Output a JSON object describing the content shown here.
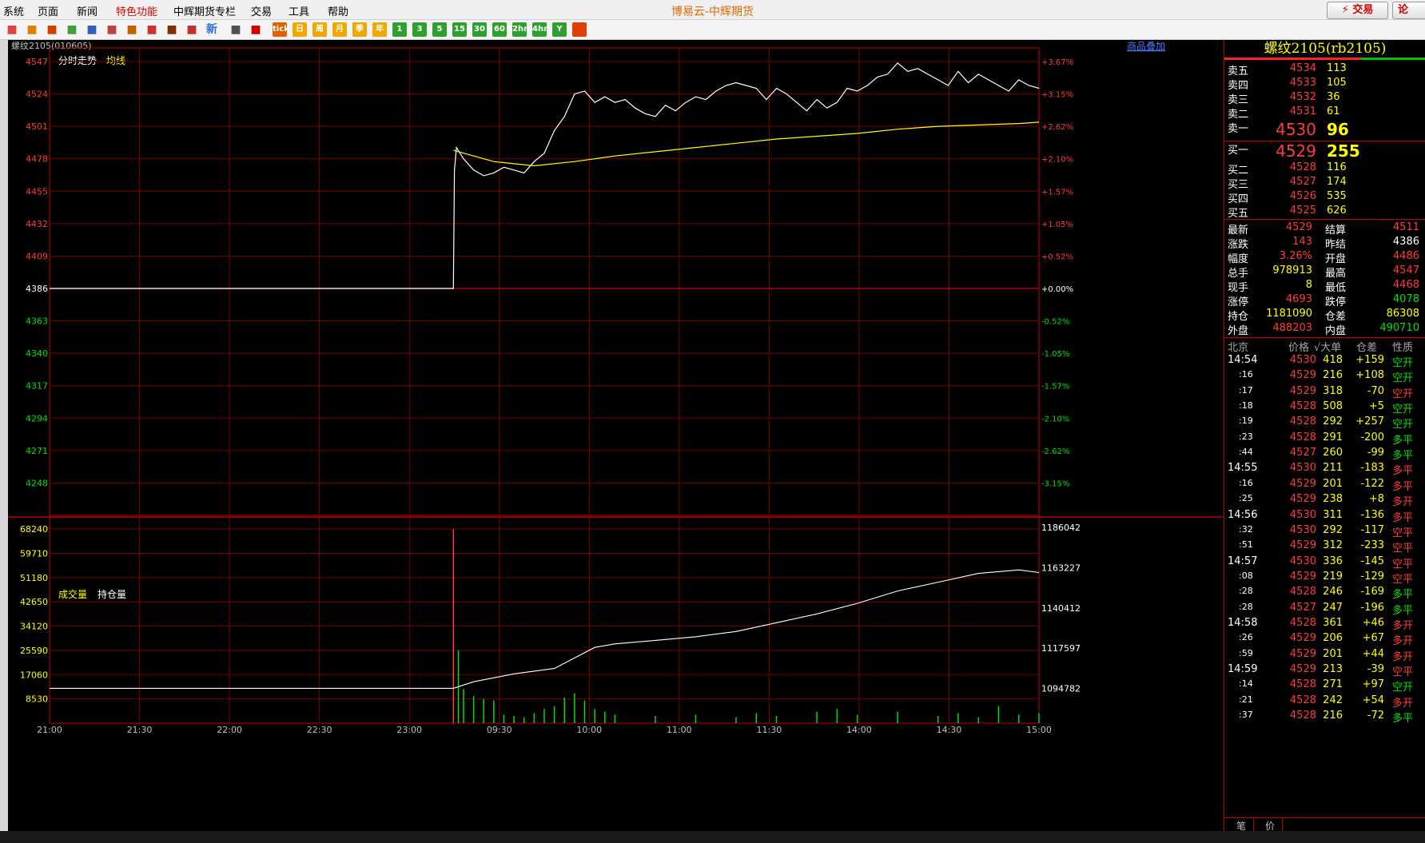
{
  "menu": {
    "items": [
      "系统",
      "页面",
      "新闻",
      "特色功能",
      "中辉期货专栏",
      "交易",
      "工具",
      "帮助"
    ],
    "highlight_index": 3
  },
  "app_title": "博易云-中辉期货",
  "buttons": {
    "trade": "⚡ 交易",
    "forum": "论"
  },
  "toolbar_icons": [
    "home-icon",
    "window-icon",
    "chart-icon",
    "refresh-icon",
    "search-icon",
    "zoom-icon",
    "layout-icon",
    "pen-icon",
    "draw-icon",
    "filter-icon",
    "news-icon",
    "table-icon",
    "trend-icon",
    "tick-icon",
    "day-icon",
    "week-icon",
    "month-icon",
    "quarter-icon",
    "year-icon",
    "1m-icon",
    "3m-icon",
    "5m-icon",
    "15m-icon",
    "30m-icon",
    "60m-icon",
    "2h-icon",
    "4h-icon",
    "y-icon",
    "calc-icon"
  ],
  "toolbar_labels": [
    "",
    "",
    "",
    "",
    "",
    "",
    "",
    "",
    "",
    "",
    "新",
    "",
    "",
    "tick",
    "日",
    "周",
    "月",
    "季",
    "年",
    "1",
    "3",
    "5",
    "15",
    "30",
    "60",
    "2hr",
    "4hr",
    "Y",
    ""
  ],
  "chart": {
    "symbol_header": "螺纹2105(010605)",
    "overlay_link": "商品叠加",
    "price_legend": [
      "分时走势",
      "均线"
    ],
    "volume_legend": [
      "成交量",
      "持仓量"
    ]
  },
  "chart_data": {
    "type": "line",
    "price_axis_ticks": [
      4547,
      4524,
      4501,
      4478,
      4455,
      4432,
      4409,
      4386,
      4363,
      4340,
      4317,
      4294,
      4271,
      4248
    ],
    "percent_axis_ticks": [
      "+3.67%",
      "+3.15%",
      "+2.62%",
      "+2.10%",
      "+1.57%",
      "+1.05%",
      "+0.52%",
      "+0.00%",
      "-0.52%",
      "-1.05%",
      "-1.57%",
      "-2.10%",
      "-2.62%",
      "-3.15%"
    ],
    "prev_settle": 4386,
    "ylim": [
      4225,
      4547
    ],
    "volume_ticks": [
      68240,
      59710,
      51180,
      42650,
      34120,
      25590,
      17060,
      8530
    ],
    "open_interest_ticks": [
      1186042,
      1163227,
      1140412,
      1117597,
      1094782
    ],
    "time_labels": [
      "21:00",
      "21:30",
      "22:00",
      "22:30",
      "23:00",
      "09:30",
      "10:00",
      "11:00",
      "11:30",
      "14:00",
      "14:30",
      "15:00"
    ],
    "price_series": [
      [
        0,
        4386
      ],
      [
        40,
        4386
      ],
      [
        40.1,
        4470
      ],
      [
        40.3,
        4486
      ],
      [
        41,
        4478
      ],
      [
        42,
        4470
      ],
      [
        43,
        4466
      ],
      [
        44,
        4468
      ],
      [
        45,
        4472
      ],
      [
        46,
        4470
      ],
      [
        47,
        4468
      ],
      [
        48,
        4476
      ],
      [
        49,
        4482
      ],
      [
        50,
        4498
      ],
      [
        51,
        4508
      ],
      [
        52,
        4524
      ],
      [
        53,
        4526
      ],
      [
        54,
        4518
      ],
      [
        55,
        4522
      ],
      [
        56,
        4518
      ],
      [
        57,
        4520
      ],
      [
        58,
        4514
      ],
      [
        59,
        4510
      ],
      [
        60,
        4508
      ],
      [
        61,
        4516
      ],
      [
        62,
        4512
      ],
      [
        63,
        4518
      ],
      [
        64,
        4522
      ],
      [
        65,
        4520
      ],
      [
        66,
        4526
      ],
      [
        67,
        4530
      ],
      [
        68,
        4532
      ],
      [
        69,
        4530
      ],
      [
        70,
        4528
      ],
      [
        71,
        4520
      ],
      [
        72,
        4528
      ],
      [
        73,
        4524
      ],
      [
        74,
        4518
      ],
      [
        75,
        4512
      ],
      [
        76,
        4520
      ],
      [
        77,
        4514
      ],
      [
        78,
        4518
      ],
      [
        79,
        4528
      ],
      [
        80,
        4526
      ],
      [
        81,
        4530
      ],
      [
        82,
        4536
      ],
      [
        83,
        4538
      ],
      [
        84,
        4546
      ],
      [
        85,
        4540
      ],
      [
        86,
        4542
      ],
      [
        87,
        4538
      ],
      [
        88,
        4534
      ],
      [
        89,
        4530
      ],
      [
        90,
        4540
      ],
      [
        91,
        4532
      ],
      [
        92,
        4538
      ],
      [
        93,
        4534
      ],
      [
        94,
        4530
      ],
      [
        95,
        4526
      ],
      [
        96,
        4534
      ],
      [
        97,
        4530
      ],
      [
        98,
        4528
      ]
    ],
    "avg_series": [
      [
        40,
        4484
      ],
      [
        44,
        4476
      ],
      [
        48,
        4473
      ],
      [
        52,
        4476
      ],
      [
        56,
        4480
      ],
      [
        60,
        4483
      ],
      [
        64,
        4486
      ],
      [
        68,
        4489
      ],
      [
        72,
        4492
      ],
      [
        76,
        4494
      ],
      [
        80,
        4496
      ],
      [
        84,
        4499
      ],
      [
        88,
        4501
      ],
      [
        92,
        4502
      ],
      [
        96,
        4503
      ],
      [
        98,
        4504
      ]
    ],
    "volume_series": [
      [
        40,
        68240
      ],
      [
        40.5,
        25590
      ],
      [
        41,
        12000
      ],
      [
        42,
        9500
      ],
      [
        43,
        8500
      ],
      [
        44,
        8000
      ],
      [
        45,
        3000
      ],
      [
        46,
        2500
      ],
      [
        47,
        2000
      ],
      [
        48,
        3500
      ],
      [
        49,
        5000
      ],
      [
        50,
        6000
      ],
      [
        51,
        9000
      ],
      [
        52,
        10500
      ],
      [
        53,
        8000
      ],
      [
        54,
        5000
      ],
      [
        55,
        4000
      ],
      [
        56,
        3000
      ],
      [
        60,
        2500
      ],
      [
        64,
        3000
      ],
      [
        68,
        2000
      ],
      [
        70,
        3500
      ],
      [
        72,
        2500
      ],
      [
        76,
        4000
      ],
      [
        78,
        5000
      ],
      [
        80,
        3000
      ],
      [
        84,
        4000
      ],
      [
        88,
        2500
      ],
      [
        90,
        3500
      ],
      [
        92,
        2000
      ],
      [
        94,
        6000
      ],
      [
        96,
        3000
      ],
      [
        98,
        3500
      ]
    ],
    "open_interest_series": [
      [
        0,
        1094782
      ],
      [
        40,
        1094782
      ],
      [
        42,
        1098500
      ],
      [
        46,
        1103000
      ],
      [
        50,
        1106000
      ],
      [
        52,
        1112000
      ],
      [
        54,
        1118000
      ],
      [
        56,
        1120000
      ],
      [
        60,
        1122000
      ],
      [
        64,
        1124000
      ],
      [
        68,
        1127000
      ],
      [
        72,
        1132000
      ],
      [
        76,
        1137000
      ],
      [
        80,
        1143000
      ],
      [
        84,
        1150000
      ],
      [
        88,
        1155000
      ],
      [
        92,
        1160000
      ],
      [
        96,
        1162000
      ],
      [
        98,
        1160500
      ]
    ]
  },
  "quote": {
    "title": "螺纹2105(rb2105)",
    "asks": [
      {
        "label": "卖五",
        "price": "4534",
        "vol": "113"
      },
      {
        "label": "卖四",
        "price": "4533",
        "vol": "105"
      },
      {
        "label": "卖三",
        "price": "4532",
        "vol": "36"
      },
      {
        "label": "卖二",
        "price": "4531",
        "vol": "61"
      },
      {
        "label": "卖一",
        "price": "4530",
        "vol": "96"
      }
    ],
    "bids": [
      {
        "label": "买一",
        "price": "4529",
        "vol": "255"
      },
      {
        "label": "买二",
        "price": "4528",
        "vol": "116"
      },
      {
        "label": "买三",
        "price": "4527",
        "vol": "174"
      },
      {
        "label": "买四",
        "price": "4526",
        "vol": "535"
      },
      {
        "label": "买五",
        "price": "4525",
        "vol": "626"
      }
    ],
    "stats": [
      {
        "l1": "最新",
        "v1": "4529",
        "c1": "red",
        "l2": "结算",
        "v2": "4511",
        "c2": "red"
      },
      {
        "l1": "涨跌",
        "v1": "143",
        "c1": "red",
        "l2": "昨结",
        "v2": "4386",
        "c2": "white"
      },
      {
        "l1": "幅度",
        "v1": "3.26%",
        "c1": "red",
        "l2": "开盘",
        "v2": "4486",
        "c2": "red"
      },
      {
        "l1": "总手",
        "v1": "978913",
        "c1": "yellow",
        "l2": "最高",
        "v2": "4547",
        "c2": "red"
      },
      {
        "l1": "现手",
        "v1": "8",
        "c1": "yellow",
        "l2": "最低",
        "v2": "4468",
        "c2": "red"
      },
      {
        "l1": "涨停",
        "v1": "4693",
        "c1": "red",
        "l2": "跌停",
        "v2": "4078",
        "c2": "green"
      },
      {
        "l1": "持仓",
        "v1": "1181090",
        "c1": "yellow",
        "l2": "仓差",
        "v2": "86308",
        "c2": "yellow"
      },
      {
        "l1": "外盘",
        "v1": "488203",
        "c1": "red",
        "l2": "内盘",
        "v2": "490710",
        "c2": "green"
      }
    ],
    "tick_headers": [
      "北京",
      "价格",
      "√大单",
      "仓差",
      "性质"
    ],
    "ticks": [
      {
        "t": "14:54",
        "p": "4530",
        "v": "418",
        "d": "+159",
        "n": "空开",
        "nc": "green"
      },
      {
        "t": ":16",
        "p": "4529",
        "v": "216",
        "d": "+108",
        "n": "空开",
        "nc": "green"
      },
      {
        "t": ":17",
        "p": "4529",
        "v": "318",
        "d": "-70",
        "n": "空开",
        "nc": "red"
      },
      {
        "t": ":18",
        "p": "4528",
        "v": "508",
        "d": "+5",
        "n": "空开",
        "nc": "green"
      },
      {
        "t": ":19",
        "p": "4528",
        "v": "292",
        "d": "+257",
        "n": "空开",
        "nc": "green"
      },
      {
        "t": ":23",
        "p": "4528",
        "v": "291",
        "d": "-200",
        "n": "多平",
        "nc": "green"
      },
      {
        "t": ":44",
        "p": "4527",
        "v": "260",
        "d": "-99",
        "n": "多平",
        "nc": "green"
      },
      {
        "t": "14:55",
        "p": "4530",
        "v": "211",
        "d": "-183",
        "n": "多平",
        "nc": "red"
      },
      {
        "t": ":16",
        "p": "4529",
        "v": "201",
        "d": "-122",
        "n": "多平",
        "nc": "red"
      },
      {
        "t": ":25",
        "p": "4529",
        "v": "238",
        "d": "+8",
        "n": "多开",
        "nc": "red"
      },
      {
        "t": "14:56",
        "p": "4530",
        "v": "311",
        "d": "-136",
        "n": "多平",
        "nc": "red"
      },
      {
        "t": ":32",
        "p": "4530",
        "v": "292",
        "d": "-117",
        "n": "空平",
        "nc": "red"
      },
      {
        "t": ":51",
        "p": "4529",
        "v": "312",
        "d": "-233",
        "n": "空平",
        "nc": "red"
      },
      {
        "t": "14:57",
        "p": "4530",
        "v": "336",
        "d": "-145",
        "n": "空平",
        "nc": "red"
      },
      {
        "t": ":08",
        "p": "4529",
        "v": "219",
        "d": "-129",
        "n": "空平",
        "nc": "red"
      },
      {
        "t": ":28",
        "p": "4528",
        "v": "246",
        "d": "-169",
        "n": "多平",
        "nc": "green"
      },
      {
        "t": ":28",
        "p": "4527",
        "v": "247",
        "d": "-196",
        "n": "多平",
        "nc": "green"
      },
      {
        "t": "14:58",
        "p": "4528",
        "v": "361",
        "d": "+46",
        "n": "多开",
        "nc": "red"
      },
      {
        "t": ":26",
        "p": "4529",
        "v": "206",
        "d": "+67",
        "n": "多开",
        "nc": "red"
      },
      {
        "t": ":59",
        "p": "4529",
        "v": "201",
        "d": "+44",
        "n": "多开",
        "nc": "red"
      },
      {
        "t": "14:59",
        "p": "4529",
        "v": "213",
        "d": "-39",
        "n": "空平",
        "nc": "red"
      },
      {
        "t": ":14",
        "p": "4528",
        "v": "271",
        "d": "+97",
        "n": "空开",
        "nc": "green"
      },
      {
        "t": ":21",
        "p": "4528",
        "v": "242",
        "d": "+54",
        "n": "多开",
        "nc": "red"
      },
      {
        "t": ":37",
        "p": "4528",
        "v": "216",
        "d": "-72",
        "n": "多平",
        "nc": "green"
      }
    ],
    "bottom_tabs": [
      "笔",
      "价"
    ]
  },
  "colors": {
    "grid": "#8b0000",
    "up": "#ff3b3b",
    "down": "#00e000",
    "price": "#ffffff",
    "avg": "#ffff00",
    "vol": "#00e000"
  }
}
